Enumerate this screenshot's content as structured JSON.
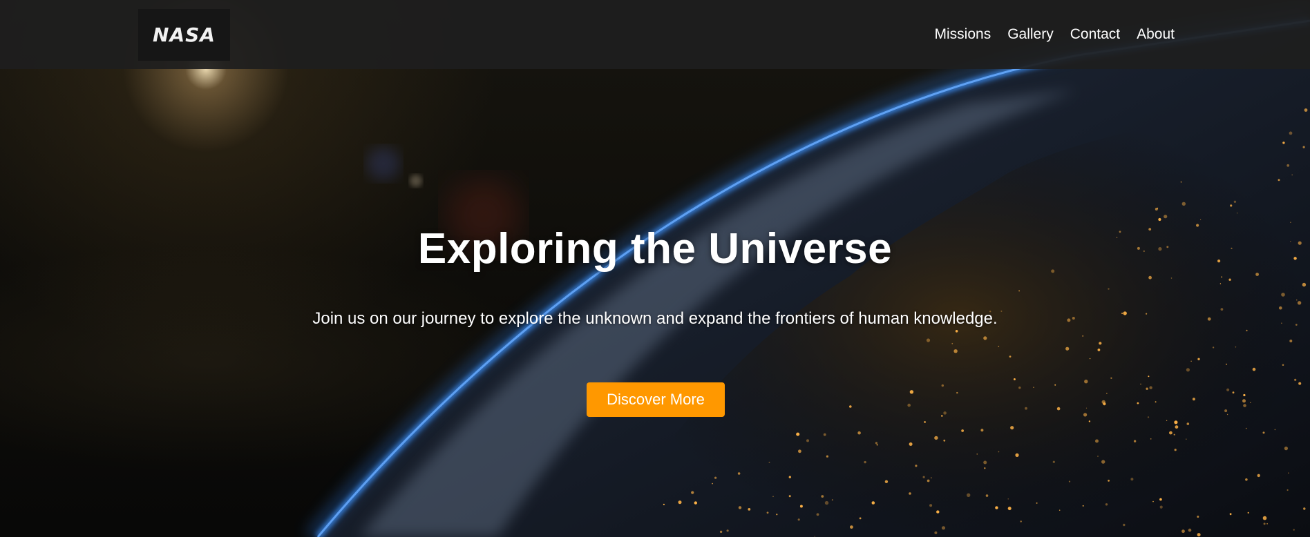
{
  "header": {
    "logo_text": "NASA",
    "nav": [
      {
        "label": "Missions"
      },
      {
        "label": "Gallery"
      },
      {
        "label": "Contact"
      },
      {
        "label": "About"
      }
    ]
  },
  "hero": {
    "title": "Exploring the Universe",
    "subtitle": "Join us on our journey to explore the unknown and expand the frontiers of human knowledge.",
    "cta_label": "Discover More",
    "background_image": "earth-from-space-at-night"
  },
  "colors": {
    "header_bg": "#1e1e1e",
    "logo_bg": "#161616",
    "cta_bg": "#ff9800",
    "text": "#ffffff",
    "atmosphere": "#3e8ef0",
    "city_lights": "#ffb347"
  }
}
